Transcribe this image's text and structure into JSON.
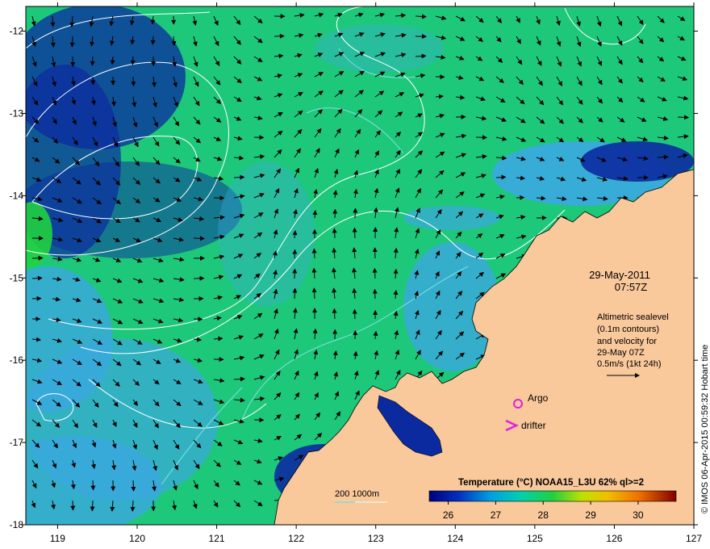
{
  "map": {
    "lon_range": [
      118.6,
      127
    ],
    "lat_range": [
      -18,
      -11.7
    ],
    "x_ticks": [
      "119",
      "120",
      "121",
      "122",
      "123",
      "124",
      "125",
      "126",
      "127"
    ],
    "y_ticks": [
      "-12",
      "-13",
      "-14",
      "-15",
      "-16",
      "-17",
      "-18"
    ],
    "land_color": "#f9c89b",
    "ocean_warm_color": "#1ec87a",
    "ocean_cool_color": "#3aa8e0",
    "ocean_cold_color": "#0b2aa0"
  },
  "annotations": {
    "date": "29-May-2011",
    "time": "07:57Z",
    "altimetry_lines": [
      "Altimetric sealevel",
      "(0.1m contours)",
      "and velocity for",
      "29-May 07Z",
      "0.5m/s (1kt 24h)"
    ],
    "copyright": "© IMOS 06-Apr-2015 00:59:32 Hobart time",
    "bathymetry_label": "200  1000m"
  },
  "legend": {
    "argo_label": "Argo",
    "drifter_label": "drifter",
    "argo_color": "#e020e0",
    "drifter_color": "#e020e0"
  },
  "colorbar": {
    "title": "Temperature (°C) NOAA15_L3U 62% ql>=2",
    "ticks": [
      "26",
      "27",
      "28",
      "29",
      "30"
    ],
    "colors": [
      "#000080",
      "#0030c0",
      "#00a0e0",
      "#00d0b0",
      "#20d040",
      "#c0e000",
      "#f0c000",
      "#f07000",
      "#c02000",
      "#800000"
    ]
  }
}
